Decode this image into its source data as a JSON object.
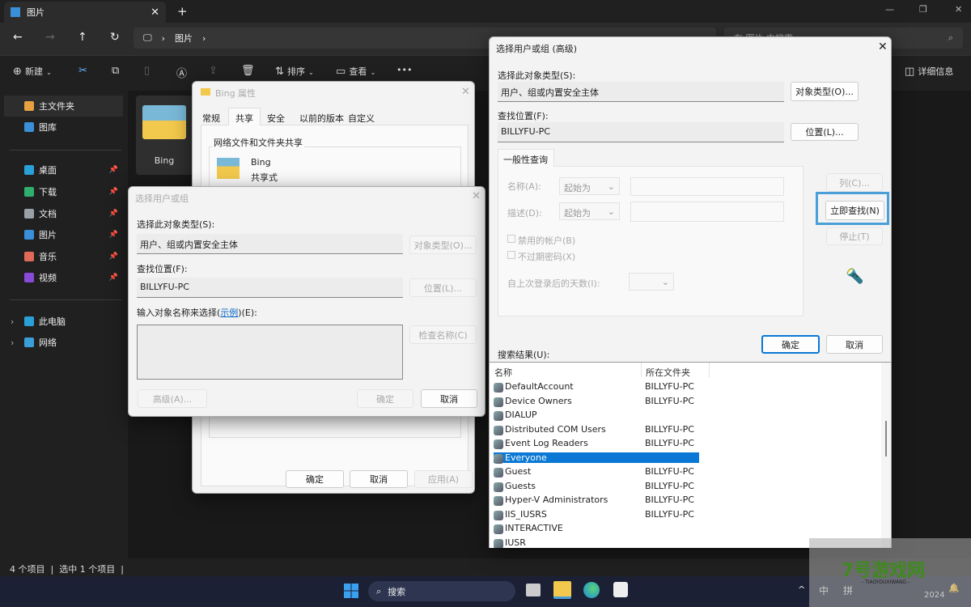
{
  "explorer": {
    "tab_title": "图片",
    "breadcrumb": [
      "图片"
    ],
    "search_placeholder": "在 图片 中搜索",
    "toolbar": {
      "new": "新建",
      "sort": "排序",
      "view": "查看",
      "more": "•••",
      "details": "详细信息"
    },
    "sidebar": [
      {
        "label": "主文件夹",
        "color": "#e8a040"
      },
      {
        "label": "图库",
        "color": "#3a8fd8"
      },
      {
        "label": "桌面",
        "color": "#2aa0d8",
        "pin": true
      },
      {
        "label": "下载",
        "color": "#2fae6e",
        "pin": true
      },
      {
        "label": "文档",
        "color": "#9aa0a8",
        "pin": true
      },
      {
        "label": "图片",
        "color": "#3a8fd8",
        "pin": true
      },
      {
        "label": "音乐",
        "color": "#e06a5a",
        "pin": true
      },
      {
        "label": "视频",
        "color": "#8a4ad8",
        "pin": true
      },
      {
        "label": "此电脑",
        "color": "#2aa0d8",
        "expand": true
      },
      {
        "label": "网络",
        "color": "#3a9fd8",
        "expand": true
      }
    ],
    "folder": {
      "name": "Bing"
    },
    "status": {
      "count": "4 个项目",
      "selected": "选中 1 个项目"
    }
  },
  "props_dialog": {
    "title": "Bing 属性",
    "tabs": [
      "常规",
      "共享",
      "安全",
      "以前的版本",
      "自定义"
    ],
    "active_tab": "共享",
    "group": "网络文件和文件夹共享",
    "folder_name": "Bing",
    "share_state": "共享式",
    "ok": "确定",
    "cancel": "取消",
    "apply": "应用(A)"
  },
  "select_dialog": {
    "title": "选择用户或组",
    "type_label": "选择此对象类型(S):",
    "type_value": "用户、组或内置安全主体",
    "type_btn": "对象类型(O)...",
    "loc_label": "查找位置(F):",
    "loc_value": "BILLYFU-PC",
    "loc_btn": "位置(L)...",
    "enter_label_a": "输入对象名称来选择(",
    "enter_link": "示例",
    "enter_label_b": ")(E):",
    "check_btn": "检查名称(C)",
    "advanced_btn": "高级(A)...",
    "ok": "确定",
    "cancel": "取消"
  },
  "adv_dialog": {
    "title": "选择用户或组 (高级)",
    "type_label": "选择此对象类型(S):",
    "type_value": "用户、组或内置安全主体",
    "type_btn": "对象类型(O)...",
    "loc_label": "查找位置(F):",
    "loc_value": "BILLYFU-PC",
    "loc_btn": "位置(L)...",
    "query_tab": "一般性查询",
    "name_label": "名称(A):",
    "name_op": "起始为",
    "desc_label": "描述(D):",
    "desc_op": "起始为",
    "cb_disabled": "禁用的帐户(B)",
    "cb_noexpire": "不过期密码(X)",
    "days_label": "自上次登录后的天数(I):",
    "columns_btn": "列(C)...",
    "find_btn": "立即查找(N)",
    "stop_btn": "停止(T)",
    "ok": "确定",
    "cancel": "取消",
    "results_label": "搜索结果(U):",
    "col_name": "名称",
    "col_folder": "所在文件夹",
    "results": [
      {
        "name": "DefaultAccount",
        "folder": "BILLYFU-PC"
      },
      {
        "name": "Device Owners",
        "folder": "BILLYFU-PC"
      },
      {
        "name": "DIALUP",
        "folder": ""
      },
      {
        "name": "Distributed COM Users",
        "folder": "BILLYFU-PC"
      },
      {
        "name": "Event Log Readers",
        "folder": "BILLYFU-PC"
      },
      {
        "name": "Everyone",
        "folder": "",
        "selected": true
      },
      {
        "name": "Guest",
        "folder": "BILLYFU-PC"
      },
      {
        "name": "Guests",
        "folder": "BILLYFU-PC"
      },
      {
        "name": "Hyper-V Administrators",
        "folder": "BILLYFU-PC"
      },
      {
        "name": "IIS_IUSRS",
        "folder": "BILLYFU-PC"
      },
      {
        "name": "INTERACTIVE",
        "folder": ""
      },
      {
        "name": "IUSR",
        "folder": ""
      }
    ]
  },
  "taskbar": {
    "search": "搜索",
    "ime1": "中",
    "ime2": "拼",
    "year": "2024"
  },
  "watermark": {
    "text": "7号游戏网",
    "sub": "- TIAOYOUXIWANG -"
  },
  "colors": {
    "accent": "#0a78d4",
    "highlight": "#4a9fd8"
  }
}
